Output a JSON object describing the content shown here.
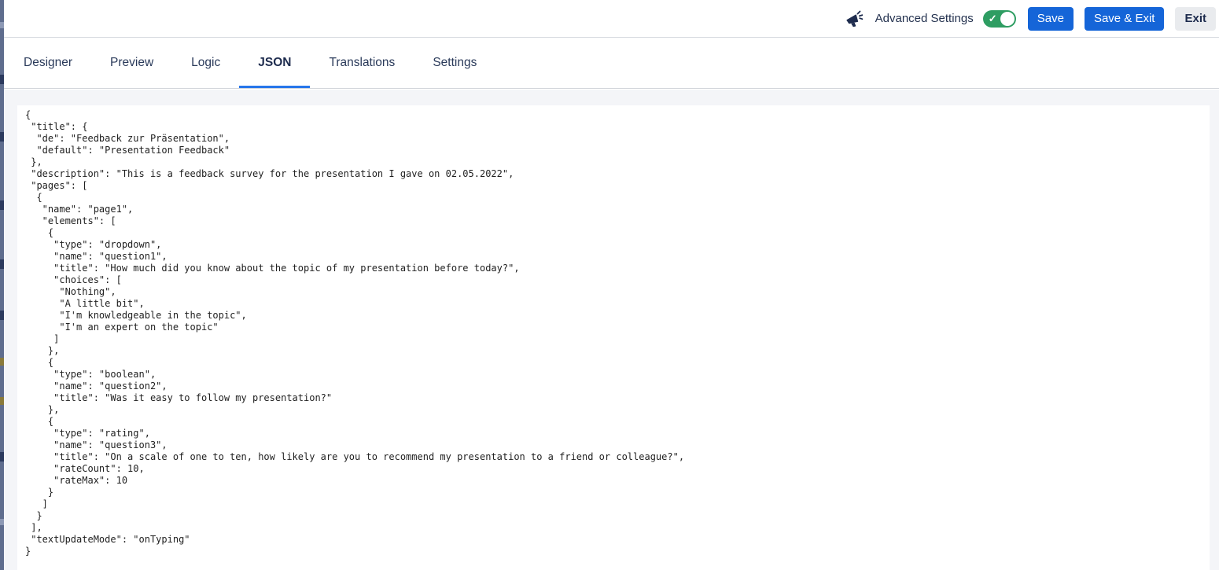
{
  "header": {
    "advanced_settings_label": "Advanced Settings",
    "advanced_settings_toggle": "on",
    "toggle_check_glyph": "✓",
    "save_label": "Save",
    "save_exit_label": "Save & Exit",
    "exit_label": "Exit"
  },
  "tabs": {
    "active": "JSON",
    "items": [
      {
        "label": "Designer"
      },
      {
        "label": "Preview"
      },
      {
        "label": "Logic"
      },
      {
        "label": "JSON"
      },
      {
        "label": "Translations"
      },
      {
        "label": "Settings"
      }
    ]
  },
  "editor": {
    "lines": [
      "{",
      " \"title\": {",
      "  \"de\": \"Feedback zur Präsentation\",",
      "  \"default\": \"Presentation Feedback\"",
      " },",
      " \"description\": \"This is a feedback survey for the presentation I gave on 02.05.2022\",",
      " \"pages\": [",
      "  {",
      "   \"name\": \"page1\",",
      "   \"elements\": [",
      "    {",
      "     \"type\": \"dropdown\",",
      "     \"name\": \"question1\",",
      "     \"title\": \"How much did you know about the topic of my presentation before today?\",",
      "     \"choices\": [",
      "      \"Nothing\",",
      "      \"A little bit\",",
      "      \"I'm knowledgeable in the topic\",",
      "      \"I'm an expert on the topic\"",
      "     ]",
      "    },",
      "    {",
      "     \"type\": \"boolean\",",
      "     \"name\": \"question2\",",
      "     \"title\": \"Was it easy to follow my presentation?\"",
      "    },",
      "    {",
      "     \"type\": \"rating\",",
      "     \"name\": \"question3\",",
      "     \"title\": \"On a scale of one to ten, how likely are you to recommend my presentation to a friend or colleague?\",",
      "     \"rateCount\": 10,",
      "     \"rateMax\": 10",
      "    }",
      "   ]",
      "  }",
      " ],",
      " \"textUpdateMode\": \"onTyping\"",
      "}"
    ]
  },
  "colors": {
    "primary_button_blue": "#1565d8",
    "tab_underline_blue": "#2776ea",
    "toggle_green": "#2e9d62",
    "navy_text": "#24324f",
    "content_background": "#f4f5f8"
  }
}
